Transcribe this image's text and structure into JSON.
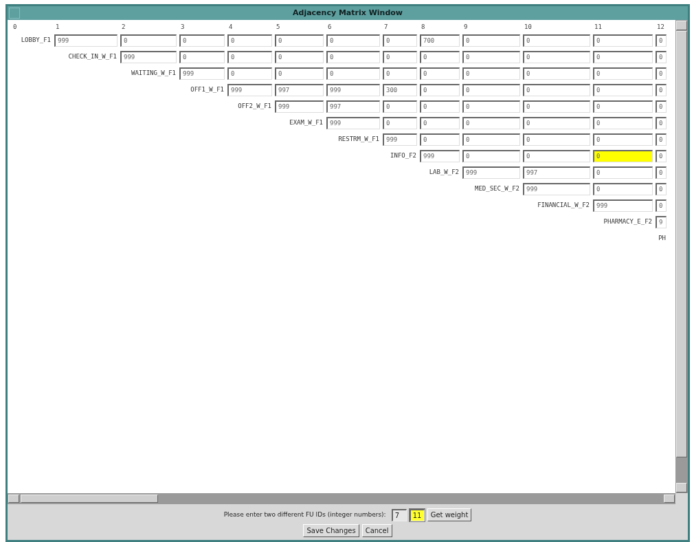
{
  "window": {
    "title": "Adjacency Matrix Window"
  },
  "matrix": {
    "column_headers": [
      "0",
      "1",
      "2",
      "3",
      "4",
      "5",
      "6",
      "7",
      "8",
      "9",
      "10",
      "11",
      "12"
    ],
    "rows": [
      {
        "label": "LOBBY_F1",
        "cells": [
          {
            "value": "999",
            "selected": false
          },
          {
            "value": "0",
            "selected": false
          },
          {
            "value": "0",
            "selected": false
          },
          {
            "value": "0",
            "selected": false
          },
          {
            "value": "0",
            "selected": false
          },
          {
            "value": "0",
            "selected": false
          },
          {
            "value": "0",
            "selected": false
          },
          {
            "value": "700",
            "selected": false
          },
          {
            "value": "0",
            "selected": false
          },
          {
            "value": "0",
            "selected": false
          },
          {
            "value": "0",
            "selected": false
          },
          {
            "value": "0",
            "selected": false
          }
        ]
      },
      {
        "label": "CHECK_IN_W_F1",
        "cells": [
          "",
          {
            "value": "999",
            "selected": false
          },
          {
            "value": "0",
            "selected": false
          },
          {
            "value": "0",
            "selected": false
          },
          {
            "value": "0",
            "selected": false
          },
          {
            "value": "0",
            "selected": false
          },
          {
            "value": "0",
            "selected": false
          },
          {
            "value": "0",
            "selected": false
          },
          {
            "value": "0",
            "selected": false
          },
          {
            "value": "0",
            "selected": false
          },
          {
            "value": "0",
            "selected": false
          },
          {
            "value": "0",
            "selected": false
          }
        ]
      },
      {
        "label": "WAITING_W_F1",
        "cells": [
          "",
          "",
          {
            "value": "999",
            "selected": false
          },
          {
            "value": "0",
            "selected": false
          },
          {
            "value": "0",
            "selected": false
          },
          {
            "value": "0",
            "selected": false
          },
          {
            "value": "0",
            "selected": false
          },
          {
            "value": "0",
            "selected": false
          },
          {
            "value": "0",
            "selected": false
          },
          {
            "value": "0",
            "selected": false
          },
          {
            "value": "0",
            "selected": false
          },
          {
            "value": "0",
            "selected": false
          }
        ]
      },
      {
        "label": "OFF1_W_F1",
        "cells": [
          "",
          "",
          "",
          {
            "value": "999",
            "selected": false
          },
          {
            "value": "997",
            "selected": false
          },
          {
            "value": "999",
            "selected": false
          },
          {
            "value": "300",
            "selected": false
          },
          {
            "value": "0",
            "selected": false
          },
          {
            "value": "0",
            "selected": false
          },
          {
            "value": "0",
            "selected": false
          },
          {
            "value": "0",
            "selected": false
          },
          {
            "value": "0",
            "selected": false
          }
        ]
      },
      {
        "label": "OFF2_W_F1",
        "cells": [
          "",
          "",
          "",
          "",
          {
            "value": "999",
            "selected": false
          },
          {
            "value": "997",
            "selected": false
          },
          {
            "value": "0",
            "selected": false
          },
          {
            "value": "0",
            "selected": false
          },
          {
            "value": "0",
            "selected": false
          },
          {
            "value": "0",
            "selected": false
          },
          {
            "value": "0",
            "selected": false
          },
          {
            "value": "0",
            "selected": false
          }
        ]
      },
      {
        "label": "EXAM_W_F1",
        "cells": [
          "",
          "",
          "",
          "",
          "",
          {
            "value": "999",
            "selected": false
          },
          {
            "value": "0",
            "selected": false
          },
          {
            "value": "0",
            "selected": false
          },
          {
            "value": "0",
            "selected": false
          },
          {
            "value": "0",
            "selected": false
          },
          {
            "value": "0",
            "selected": false
          },
          {
            "value": "0",
            "selected": false
          }
        ]
      },
      {
        "label": "RESTRM_W_F1",
        "cells": [
          "",
          "",
          "",
          "",
          "",
          "",
          {
            "value": "999",
            "selected": false
          },
          {
            "value": "0",
            "selected": false
          },
          {
            "value": "0",
            "selected": false
          },
          {
            "value": "0",
            "selected": false
          },
          {
            "value": "0",
            "selected": false
          },
          {
            "value": "0",
            "selected": false
          }
        ]
      },
      {
        "label": "INFO_F2",
        "cells": [
          "",
          "",
          "",
          "",
          "",
          "",
          "",
          {
            "value": "999",
            "selected": false
          },
          {
            "value": "0",
            "selected": false
          },
          {
            "value": "0",
            "selected": false
          },
          {
            "value": "0",
            "selected": true
          },
          {
            "value": "0",
            "selected": false
          }
        ]
      },
      {
        "label": "LAB_W_F2",
        "cells": [
          "",
          "",
          "",
          "",
          "",
          "",
          "",
          "",
          {
            "value": "999",
            "selected": false
          },
          {
            "value": "997",
            "selected": false
          },
          {
            "value": "0",
            "selected": false
          },
          {
            "value": "0",
            "selected": false
          }
        ]
      },
      {
        "label": "MED_SEC_W_F2",
        "cells": [
          "",
          "",
          "",
          "",
          "",
          "",
          "",
          "",
          "",
          {
            "value": "999",
            "selected": false
          },
          {
            "value": "0",
            "selected": false
          },
          {
            "value": "0",
            "selected": false
          }
        ]
      },
      {
        "label": "FINANCIAL_W_F2",
        "cells": [
          "",
          "",
          "",
          "",
          "",
          "",
          "",
          "",
          "",
          "",
          {
            "value": "999",
            "selected": false
          },
          {
            "value": "0",
            "selected": false
          }
        ]
      },
      {
        "label": "PHARMACY_E_F2",
        "cells": [
          "",
          "",
          "",
          "",
          "",
          "",
          "",
          "",
          "",
          "",
          "",
          {
            "value": "9",
            "selected": false
          }
        ]
      },
      {
        "label": "PH",
        "cells": []
      }
    ]
  },
  "prompt": {
    "label": "Please enter two different FU IDs (integer numbers):",
    "fields": [
      {
        "value": "7",
        "focused": false
      },
      {
        "value": "11",
        "focused": true
      }
    ],
    "button": "Get weight"
  },
  "buttons": [
    "Save Changes",
    "Cancel"
  ]
}
